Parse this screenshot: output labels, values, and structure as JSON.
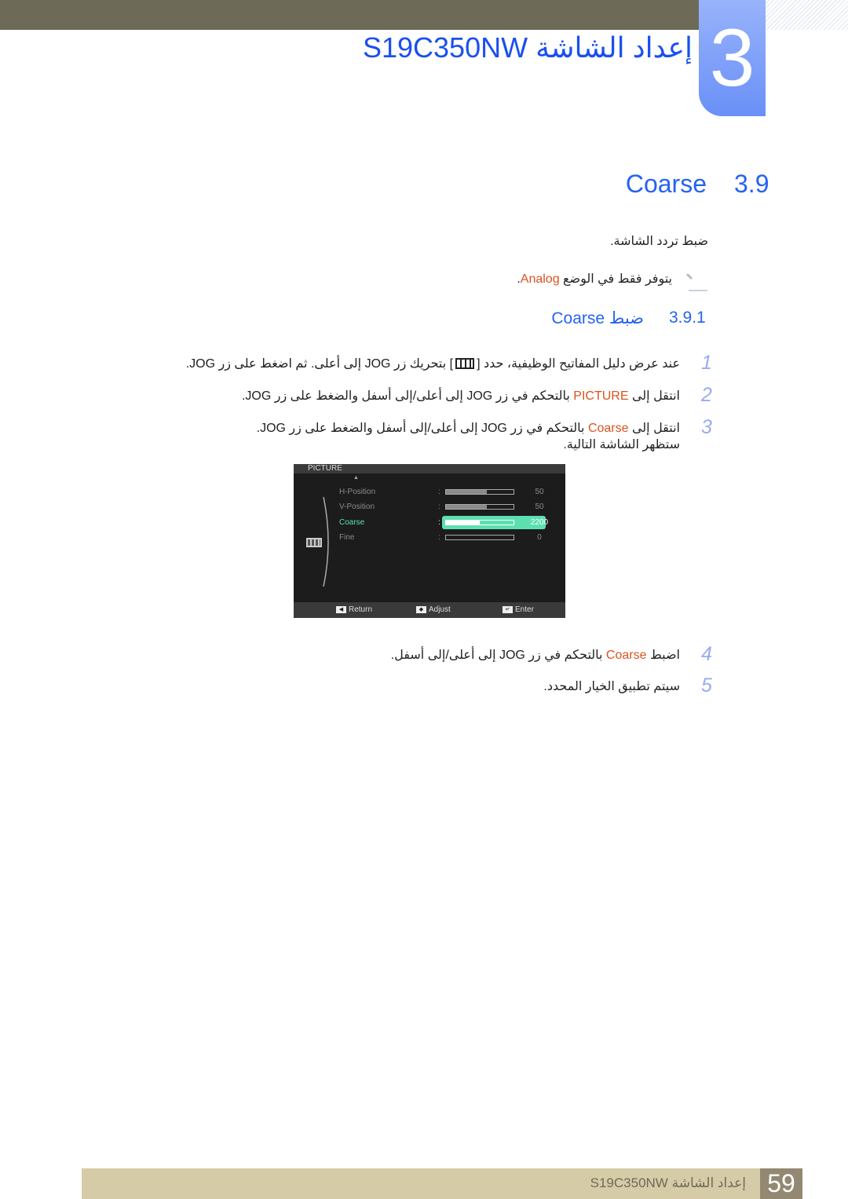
{
  "header": {
    "chapter_number": "3",
    "title": "إعداد الشاشة S19C350NW"
  },
  "section": {
    "number": "3.9",
    "title": "Coarse"
  },
  "intro": "ضبط تردد الشاشة.",
  "note": {
    "icon": "note-pencil-icon",
    "before": "يتوفر فقط في الوضع ",
    "highlight": "Analog",
    "after": "."
  },
  "subsection": {
    "number": "3.9.1",
    "title": "ضبط Coarse"
  },
  "steps": [
    {
      "num": "1",
      "before": "عند عرض دليل المفاتيح الوظيفية، حدد [",
      "icon": "picture-menu-icon",
      "after": "] بتحريك زر JOG إلى أعلى. ثم اضغط على زر JOG."
    },
    {
      "num": "2",
      "before": "انتقل إلى ",
      "highlight": "PICTURE",
      "after": " بالتحكم في زر JOG إلى أعلى/إلى أسفل والضغط على زر JOG."
    },
    {
      "num": "3",
      "before": "انتقل إلى ",
      "highlight": "Coarse",
      "after": " بالتحكم في زر JOG إلى أعلى/إلى أسفل والضغط على زر JOG.",
      "line2": "ستظهر الشاشة التالية."
    },
    {
      "num": "4",
      "before": "اضبط ",
      "highlight": "Coarse",
      "after": " بالتحكم في زر JOG إلى أعلى/إلى أسفل."
    },
    {
      "num": "5",
      "before": "سيتم تطبيق الخيار المحدد."
    }
  ],
  "osd": {
    "title": "PICTURE",
    "items": [
      {
        "label": "H-Position",
        "value": "50",
        "fill": 0.6
      },
      {
        "label": "V-Position",
        "value": "50",
        "fill": 0.6
      },
      {
        "label": "Coarse",
        "value": "2200",
        "fill": 0.5,
        "selected": true
      },
      {
        "label": "Fine",
        "value": "0",
        "fill": 0
      }
    ],
    "footer": {
      "return": "Return",
      "adjust": "Adjust",
      "enter": "Enter"
    }
  },
  "footer": {
    "text": "إعداد الشاشة S19C350NW",
    "page": "59"
  },
  "colors": {
    "accent": "#2563f0",
    "highlight": "#d9531e",
    "osd_selected": "#5de0b0"
  }
}
